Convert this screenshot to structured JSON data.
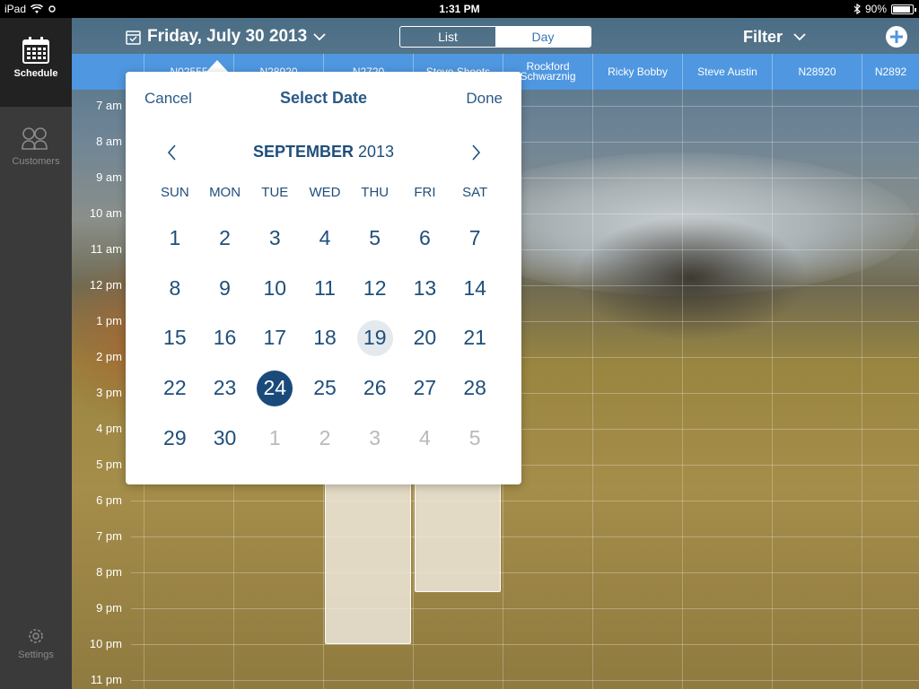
{
  "status_bar": {
    "device": "iPad",
    "time": "1:31 PM",
    "battery": "90%",
    "battery_level": 0.9
  },
  "sidebar": {
    "items": [
      {
        "label": "Schedule",
        "icon": "calendar-icon",
        "active": true
      },
      {
        "label": "Customers",
        "icon": "customers-icon",
        "active": false
      },
      {
        "label": "Settings",
        "icon": "gear-icon",
        "active": false
      }
    ]
  },
  "toolbar": {
    "date": "Friday, July 30 2013",
    "view_toggle": {
      "options": [
        "List",
        "Day"
      ],
      "selected": "Day"
    },
    "filter_label": "Filter"
  },
  "resources": [
    "N02555",
    "N28920",
    "N2720",
    "Steve Shoots",
    "Rockford Schwarznig",
    "Ricky Bobby",
    "Steve Austin",
    "N28920",
    "N2892"
  ],
  "time_slots": [
    "7 am",
    "8 am",
    "9 am",
    "10 am",
    "11 am",
    "12 pm",
    "1 pm",
    "2 pm",
    "3 pm",
    "4 pm",
    "5 pm",
    "6 pm",
    "7 pm",
    "8 pm",
    "9 pm",
    "10 pm",
    "11 pm"
  ],
  "date_picker": {
    "cancel_label": "Cancel",
    "title": "Select Date",
    "done_label": "Done",
    "month": "SEPTEMBER",
    "year": "2013",
    "weekdays": [
      "SUN",
      "MON",
      "TUE",
      "WED",
      "THU",
      "FRI",
      "SAT"
    ],
    "days": [
      {
        "d": "1"
      },
      {
        "d": "2"
      },
      {
        "d": "3"
      },
      {
        "d": "4"
      },
      {
        "d": "5"
      },
      {
        "d": "6"
      },
      {
        "d": "7"
      },
      {
        "d": "8"
      },
      {
        "d": "9"
      },
      {
        "d": "10"
      },
      {
        "d": "11"
      },
      {
        "d": "12"
      },
      {
        "d": "13"
      },
      {
        "d": "14"
      },
      {
        "d": "15"
      },
      {
        "d": "16"
      },
      {
        "d": "17"
      },
      {
        "d": "18"
      },
      {
        "d": "19",
        "state": "today"
      },
      {
        "d": "20"
      },
      {
        "d": "21"
      },
      {
        "d": "22"
      },
      {
        "d": "23"
      },
      {
        "d": "24",
        "state": "selected"
      },
      {
        "d": "25"
      },
      {
        "d": "26"
      },
      {
        "d": "27"
      },
      {
        "d": "28"
      },
      {
        "d": "29"
      },
      {
        "d": "30"
      },
      {
        "d": "1",
        "state": "other"
      },
      {
        "d": "2",
        "state": "other"
      },
      {
        "d": "3",
        "state": "other"
      },
      {
        "d": "4",
        "state": "other"
      },
      {
        "d": "5",
        "state": "other"
      }
    ]
  },
  "colors": {
    "accent": "#4f97e0",
    "selected_day": "#194a7a",
    "text_blue": "#1f4e7a"
  }
}
